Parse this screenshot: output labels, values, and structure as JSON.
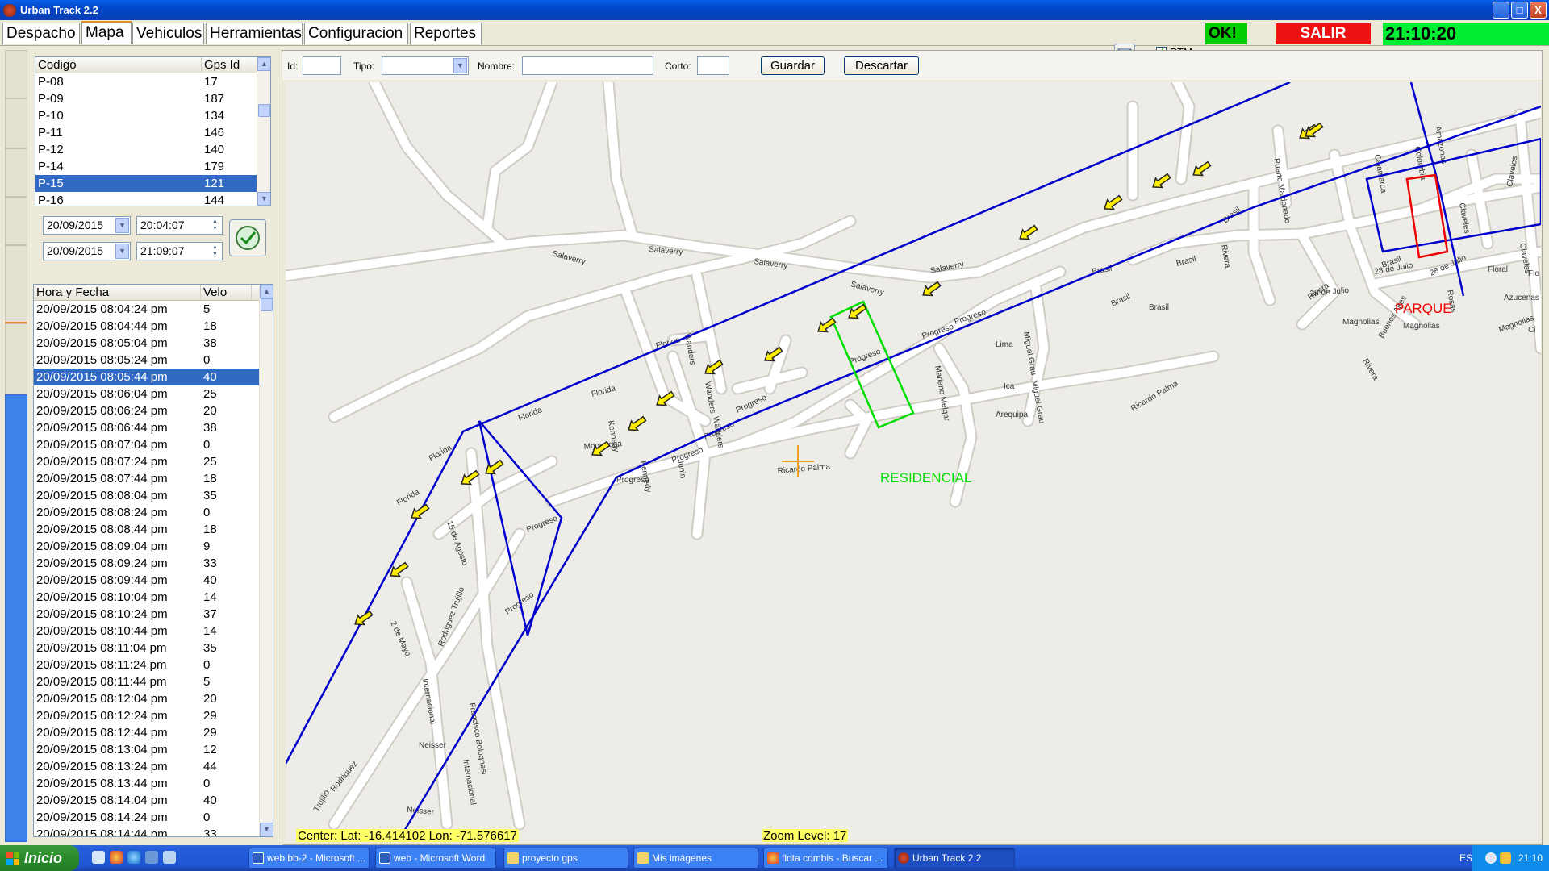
{
  "window": {
    "title": "Urban Track 2.2",
    "buttons": {
      "minimize": "_",
      "maximize": "□",
      "close": "X"
    }
  },
  "menu": {
    "tabs": [
      {
        "label": "Despacho"
      },
      {
        "label": "Mapa",
        "active": true
      },
      {
        "label": "Vehiculos"
      },
      {
        "label": "Herramientas"
      },
      {
        "label": "Configuracion"
      },
      {
        "label": "Reportes"
      }
    ]
  },
  "status": {
    "rtm_label": "RTM",
    "rtm_checked": true,
    "ok_label": "OK!",
    "salir_label": "SALIR",
    "clock": "21:10:20",
    "colors": {
      "ok": "#00cc00",
      "salir": "#ee1111",
      "clock": "#00ee33"
    }
  },
  "vehicles": {
    "columns": [
      "Codigo",
      "Gps Id"
    ],
    "rows": [
      {
        "codigo": "P-08",
        "gps": "17"
      },
      {
        "codigo": "P-09",
        "gps": "187"
      },
      {
        "codigo": "P-10",
        "gps": "134"
      },
      {
        "codigo": "P-11",
        "gps": "146"
      },
      {
        "codigo": "P-12",
        "gps": "140"
      },
      {
        "codigo": "P-14",
        "gps": "179"
      },
      {
        "codigo": "P-15",
        "gps": "121",
        "selected": true
      },
      {
        "codigo": "P-16",
        "gps": "144"
      }
    ]
  },
  "range": {
    "start_date": "20/09/2015",
    "start_time": "20:04:07",
    "end_date": "20/09/2015",
    "end_time": "21:09:07"
  },
  "history": {
    "columns": [
      "Hora y Fecha",
      "Velo"
    ],
    "rows": [
      {
        "t": "20/09/2015  08:04:24 pm",
        "v": "5"
      },
      {
        "t": "20/09/2015  08:04:44 pm",
        "v": "18"
      },
      {
        "t": "20/09/2015  08:05:04 pm",
        "v": "38"
      },
      {
        "t": "20/09/2015  08:05:24 pm",
        "v": "0"
      },
      {
        "t": "20/09/2015  08:05:44 pm",
        "v": "40",
        "selected": true
      },
      {
        "t": "20/09/2015  08:06:04 pm",
        "v": "25"
      },
      {
        "t": "20/09/2015  08:06:24 pm",
        "v": "20"
      },
      {
        "t": "20/09/2015  08:06:44 pm",
        "v": "38"
      },
      {
        "t": "20/09/2015  08:07:04 pm",
        "v": "0"
      },
      {
        "t": "20/09/2015  08:07:24 pm",
        "v": "25"
      },
      {
        "t": "20/09/2015  08:07:44 pm",
        "v": "18"
      },
      {
        "t": "20/09/2015  08:08:04 pm",
        "v": "35"
      },
      {
        "t": "20/09/2015  08:08:24 pm",
        "v": "0"
      },
      {
        "t": "20/09/2015  08:08:44 pm",
        "v": "18"
      },
      {
        "t": "20/09/2015  08:09:04 pm",
        "v": "9"
      },
      {
        "t": "20/09/2015  08:09:24 pm",
        "v": "33"
      },
      {
        "t": "20/09/2015  08:09:44 pm",
        "v": "40"
      },
      {
        "t": "20/09/2015  08:10:04 pm",
        "v": "14"
      },
      {
        "t": "20/09/2015  08:10:24 pm",
        "v": "37"
      },
      {
        "t": "20/09/2015  08:10:44 pm",
        "v": "14"
      },
      {
        "t": "20/09/2015  08:11:04 pm",
        "v": "35"
      },
      {
        "t": "20/09/2015  08:11:24 pm",
        "v": "0"
      },
      {
        "t": "20/09/2015  08:11:44 pm",
        "v": "5"
      },
      {
        "t": "20/09/2015  08:12:04 pm",
        "v": "20"
      },
      {
        "t": "20/09/2015  08:12:24 pm",
        "v": "29"
      },
      {
        "t": "20/09/2015  08:12:44 pm",
        "v": "29"
      },
      {
        "t": "20/09/2015  08:13:04 pm",
        "v": "12"
      },
      {
        "t": "20/09/2015  08:13:24 pm",
        "v": "44"
      },
      {
        "t": "20/09/2015  08:13:44 pm",
        "v": "0"
      },
      {
        "t": "20/09/2015  08:14:04 pm",
        "v": "40"
      },
      {
        "t": "20/09/2015  08:14:24 pm",
        "v": "0"
      },
      {
        "t": "20/09/2015  08:14:44 pm",
        "v": "33"
      }
    ]
  },
  "form": {
    "id_label": "Id:",
    "id_value": "",
    "tipo_label": "Tipo:",
    "tipo_value": "",
    "nombre_label": "Nombre:",
    "nombre_value": "",
    "corto_label": "Corto:",
    "corto_value": "",
    "guardar": "Guardar",
    "descartar": "Descartar"
  },
  "map": {
    "center_text": "Center:  Lat: -16.414102  Lon: -71.576617",
    "zoom_text": "Zoom Level: 17",
    "zones": [
      {
        "name": "RESIDENCIAL",
        "color": "#00dd00"
      },
      {
        "name": "PARQUE",
        "color": "#ee0000"
      }
    ],
    "route_color": "#0000cc",
    "streets": [
      "Salaverry",
      "Salaverry",
      "Salaverry",
      "Salaverry",
      "Salaverry",
      "Florida",
      "Florida",
      "Florida",
      "Florida",
      "Florida",
      "Progreso",
      "Progreso",
      "Progreso",
      "Progreso",
      "Progreso",
      "Progreso",
      "Progreso",
      "Progreso",
      "Progreso",
      "Wanders",
      "Wanders",
      "Wanders",
      "Kennedy",
      "Kennedy",
      "Moquegua",
      "Junin",
      "Ricardo Palma",
      "Ricardo Palma",
      "15 de Agosto",
      "Rodriguez Trujillo",
      "Rodriguez",
      "2 de Mayo",
      "Internacional",
      "Internacional",
      "Francisco Bolognesi",
      "Neisser",
      "Neisser",
      "Trujillo",
      "Mariano Melgar",
      "Lima",
      "Ica",
      "Arequipa",
      "Miguel Grau",
      "Miguel Grau",
      "Brasil",
      "Brasil",
      "Brasil",
      "Brasil",
      "Brasil",
      "Brasil",
      "Rivera",
      "Rivera",
      "Rivera",
      "28 de Julio",
      "28 de Julio",
      "28 de Julio",
      "Puerto Maldonado",
      "Cajamarca",
      "Colombia",
      "Amazonas",
      "Claveles",
      "Claveles",
      "Claveles",
      "Rosas",
      "Magnolias",
      "Magnolias",
      "Magnolias",
      "Buenos Aires",
      "Azucenas",
      "Floral",
      "Flo",
      "Ci"
    ]
  },
  "taskbar": {
    "start_label": "Inicio",
    "tasks": [
      {
        "label": "web bb-2 - Microsoft ..."
      },
      {
        "label": "web - Microsoft Word"
      },
      {
        "label": "proyecto gps"
      },
      {
        "label": "Mis imágenes"
      },
      {
        "label": "flota combis - Buscar ..."
      },
      {
        "label": "Urban Track 2.2",
        "active": true
      }
    ],
    "tray_lang": "ES",
    "tray_clock": "21:10"
  }
}
